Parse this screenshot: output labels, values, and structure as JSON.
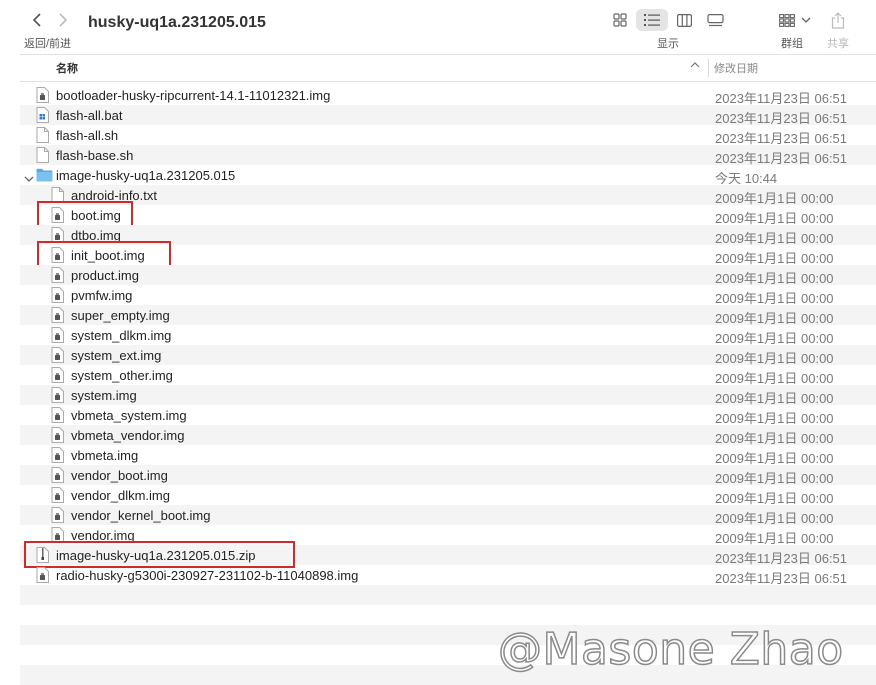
{
  "toolbar": {
    "back_forward_label": "返回/前进",
    "window_title": "husky-uq1a.231205.015",
    "view_label": "显示",
    "group_label": "群组",
    "share_label": "共享"
  },
  "columns": {
    "name": "名称",
    "modified": "修改日期"
  },
  "files": [
    {
      "name": "bootloader-husky-ripcurrent-14.1-11012321.img",
      "date": "2023年11月23日 06:51",
      "icon": "disk-image-icon",
      "indent": 0
    },
    {
      "name": "flash-all.bat",
      "date": "2023年11月23日 06:51",
      "icon": "bat-file-icon",
      "indent": 0
    },
    {
      "name": "flash-all.sh",
      "date": "2023年11月23日 06:51",
      "icon": "document-icon",
      "indent": 0
    },
    {
      "name": "flash-base.sh",
      "date": "2023年11月23日 06:51",
      "icon": "document-icon",
      "indent": 0
    },
    {
      "name": "image-husky-uq1a.231205.015",
      "date": "今天 10:44",
      "icon": "folder-icon",
      "indent": 0,
      "expanded": true
    },
    {
      "name": "android-info.txt",
      "date": "2009年1月1日 00:00",
      "icon": "document-icon",
      "indent": 1
    },
    {
      "name": "boot.img",
      "date": "2009年1月1日 00:00",
      "icon": "disk-image-icon",
      "indent": 1
    },
    {
      "name": "dtbo.img",
      "date": "2009年1月1日 00:00",
      "icon": "disk-image-icon",
      "indent": 1
    },
    {
      "name": "init_boot.img",
      "date": "2009年1月1日 00:00",
      "icon": "disk-image-icon",
      "indent": 1
    },
    {
      "name": "product.img",
      "date": "2009年1月1日 00:00",
      "icon": "disk-image-icon",
      "indent": 1
    },
    {
      "name": "pvmfw.img",
      "date": "2009年1月1日 00:00",
      "icon": "disk-image-icon",
      "indent": 1
    },
    {
      "name": "super_empty.img",
      "date": "2009年1月1日 00:00",
      "icon": "disk-image-icon",
      "indent": 1
    },
    {
      "name": "system_dlkm.img",
      "date": "2009年1月1日 00:00",
      "icon": "disk-image-icon",
      "indent": 1
    },
    {
      "name": "system_ext.img",
      "date": "2009年1月1日 00:00",
      "icon": "disk-image-icon",
      "indent": 1
    },
    {
      "name": "system_other.img",
      "date": "2009年1月1日 00:00",
      "icon": "disk-image-icon",
      "indent": 1
    },
    {
      "name": "system.img",
      "date": "2009年1月1日 00:00",
      "icon": "disk-image-icon",
      "indent": 1
    },
    {
      "name": "vbmeta_system.img",
      "date": "2009年1月1日 00:00",
      "icon": "disk-image-icon",
      "indent": 1
    },
    {
      "name": "vbmeta_vendor.img",
      "date": "2009年1月1日 00:00",
      "icon": "disk-image-icon",
      "indent": 1
    },
    {
      "name": "vbmeta.img",
      "date": "2009年1月1日 00:00",
      "icon": "disk-image-icon",
      "indent": 1
    },
    {
      "name": "vendor_boot.img",
      "date": "2009年1月1日 00:00",
      "icon": "disk-image-icon",
      "indent": 1
    },
    {
      "name": "vendor_dlkm.img",
      "date": "2009年1月1日 00:00",
      "icon": "disk-image-icon",
      "indent": 1
    },
    {
      "name": "vendor_kernel_boot.img",
      "date": "2009年1月1日 00:00",
      "icon": "disk-image-icon",
      "indent": 1
    },
    {
      "name": "vendor.img",
      "date": "2009年1月1日 00:00",
      "icon": "disk-image-icon",
      "indent": 1
    },
    {
      "name": "image-husky-uq1a.231205.015.zip",
      "date": "2023年11月23日 06:51",
      "icon": "zip-archive-icon",
      "indent": 0
    },
    {
      "name": "radio-husky-g5300i-230927-231102-b-11040898.img",
      "date": "2023年11月23日 06:51",
      "icon": "disk-image-icon",
      "indent": 0
    }
  ],
  "empty_rows": 5,
  "highlighted_files": [
    "boot.img",
    "init_boot.img",
    "image-husky-uq1a.231205.015.zip"
  ],
  "watermark": "@Masone Zhao",
  "colors": {
    "folder": "#5aa9e6",
    "highlight_box": "#d22a2a",
    "row_stripe": "#f4f4f4"
  }
}
